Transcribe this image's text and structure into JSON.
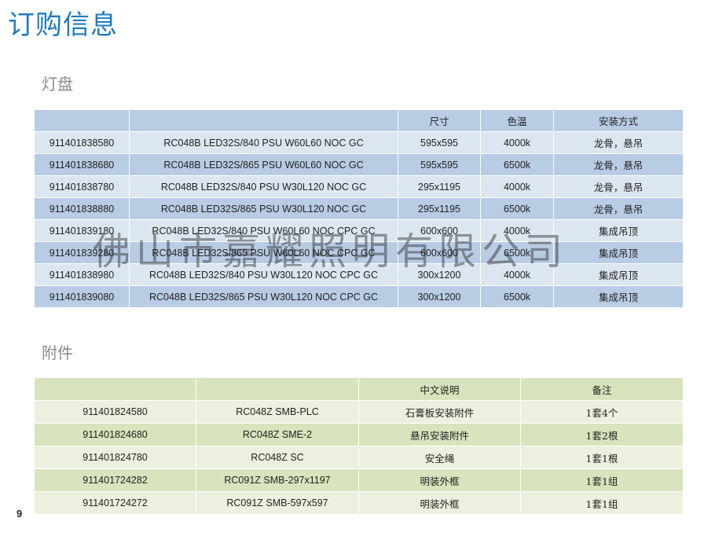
{
  "title": "订购信息",
  "section1": {
    "heading": "灯盘",
    "header": [
      "",
      "",
      "尺寸",
      "色温",
      "安装方式"
    ],
    "rows": [
      [
        "911401838580",
        "RC048B LED32S/840 PSU W60L60 NOC GC",
        "595x595",
        "4000k",
        "龙骨，悬吊"
      ],
      [
        "911401838680",
        "RC048B LED32S/865 PSU W60L60 NOC GC",
        "595x595",
        "6500k",
        "龙骨，悬吊"
      ],
      [
        "911401838780",
        "RC048B LED32S/840 PSU W30L120 NOC GC",
        "295x1195",
        "4000k",
        "龙骨，悬吊"
      ],
      [
        "911401838880",
        "RC048B LED32S/865 PSU W30L120 NOC GC",
        "295x1195",
        "6500k",
        "龙骨，悬吊"
      ],
      [
        "911401839180",
        "RC048B LED32S/840 PSU W60L60 NOC CPC GC",
        "600x600",
        "4000k",
        "集成吊顶"
      ],
      [
        "911401839280",
        "RC048B LED32S/865 PSU W60L60 NOC CPC GC",
        "600x600",
        "6500k",
        "集成吊顶"
      ],
      [
        "911401838980",
        "RC048B LED32S/840 PSU W30L120 NOC CPC GC",
        "300x1200",
        "4000k",
        "集成吊顶"
      ],
      [
        "911401839080",
        "RC048B LED32S/865 PSU W30L120 NOC CPC GC",
        "300x1200",
        "6500k",
        "集成吊顶"
      ]
    ]
  },
  "section2": {
    "heading": "附件",
    "header": [
      "",
      "",
      "中文说明",
      "备注"
    ],
    "rows": [
      [
        "911401824580",
        "RC048Z SMB-PLC",
        "石膏板安装附件",
        "1套4个"
      ],
      [
        "911401824680",
        "RC048Z SME-2",
        "悬吊安装附件",
        "1套2根"
      ],
      [
        "911401824780",
        "RC048Z SC",
        "安全绳",
        "1套1根"
      ],
      [
        "911401724282",
        "RC091Z SMB-297x1197",
        "明装外框",
        "1套1组"
      ],
      [
        "911401724272",
        "RC091Z SMB-597x597",
        "明装外框",
        "1套1组"
      ]
    ]
  },
  "watermark": "佛山市嘉耀照明有限公司",
  "page_number": "9",
  "colors": {
    "title": "#1e7ac0",
    "table1_dark": "#b8cce4",
    "table1_light": "#dce6f1",
    "table2_dark": "#d7e4bd",
    "table2_light": "#ebf1de"
  }
}
